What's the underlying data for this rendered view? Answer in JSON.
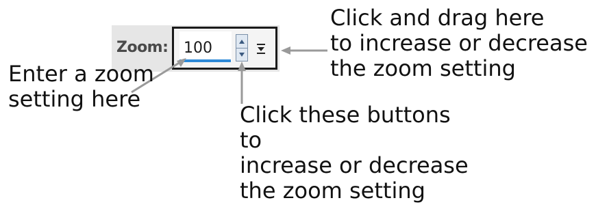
{
  "zoom_control": {
    "label": "Zoom:",
    "value": "100"
  },
  "callouts": {
    "entry": {
      "lines": [
        "Enter a zoom",
        "setting here"
      ]
    },
    "buttons": {
      "lines": [
        "Click these buttons",
        "to",
        "increase or decrease",
        "the zoom setting"
      ]
    },
    "drag": {
      "lines": [
        "Click and drag here",
        "to increase or decrease",
        "the zoom setting"
      ]
    }
  },
  "icons": {
    "spin_up": "triangle-up-icon",
    "spin_down": "triangle-down-icon",
    "dropdown": "dropdown-arrow-icon"
  },
  "colors": {
    "arrow": "#9a9a9a",
    "drag_bar": "#2e8ad8",
    "border": "#1a1a1a"
  }
}
